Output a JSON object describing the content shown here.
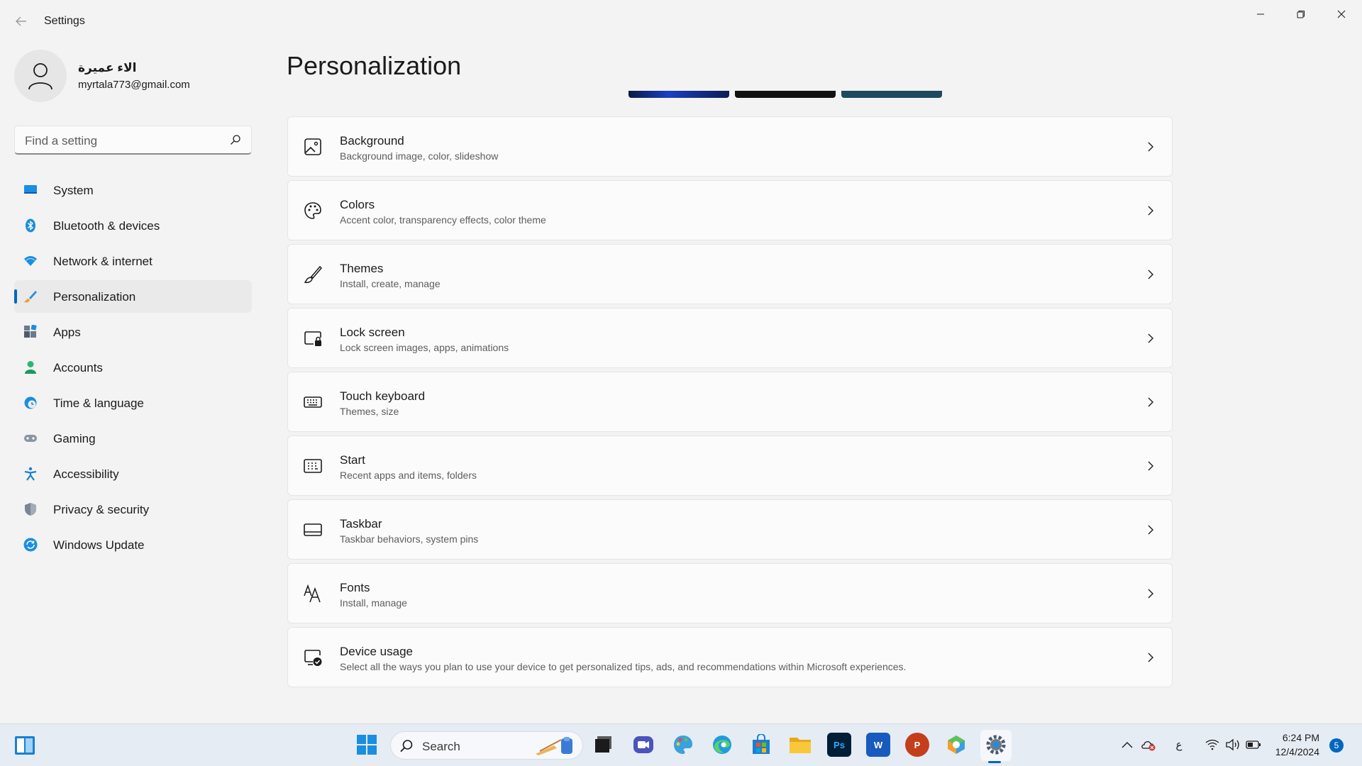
{
  "window": {
    "title": "Settings"
  },
  "profile": {
    "name": "الاء عميرة",
    "email": "myrtala773@gmail.com"
  },
  "search": {
    "placeholder": "Find a setting"
  },
  "sidebar": {
    "items": [
      {
        "label": "System",
        "icon": "system-icon",
        "active": false
      },
      {
        "label": "Bluetooth & devices",
        "icon": "bluetooth-icon",
        "active": false
      },
      {
        "label": "Network & internet",
        "icon": "wifi-icon",
        "active": false
      },
      {
        "label": "Personalization",
        "icon": "brush-icon",
        "active": true
      },
      {
        "label": "Apps",
        "icon": "apps-icon",
        "active": false
      },
      {
        "label": "Accounts",
        "icon": "accounts-icon",
        "active": false
      },
      {
        "label": "Time & language",
        "icon": "globe-clock-icon",
        "active": false
      },
      {
        "label": "Gaming",
        "icon": "gamepad-icon",
        "active": false
      },
      {
        "label": "Accessibility",
        "icon": "accessibility-icon",
        "active": false
      },
      {
        "label": "Privacy & security",
        "icon": "shield-icon",
        "active": false
      },
      {
        "label": "Windows Update",
        "icon": "update-icon",
        "active": false
      }
    ]
  },
  "main": {
    "title": "Personalization",
    "cards": [
      {
        "title": "Background",
        "subtitle": "Background image, color, slideshow",
        "icon": "image-icon"
      },
      {
        "title": "Colors",
        "subtitle": "Accent color, transparency effects, color theme",
        "icon": "palette-icon"
      },
      {
        "title": "Themes",
        "subtitle": "Install, create, manage",
        "icon": "brush-icon"
      },
      {
        "title": "Lock screen",
        "subtitle": "Lock screen images, apps, animations",
        "icon": "lock-screen-icon"
      },
      {
        "title": "Touch keyboard",
        "subtitle": "Themes, size",
        "icon": "keyboard-icon"
      },
      {
        "title": "Start",
        "subtitle": "Recent apps and items, folders",
        "icon": "start-icon"
      },
      {
        "title": "Taskbar",
        "subtitle": "Taskbar behaviors, system pins",
        "icon": "taskbar-icon"
      },
      {
        "title": "Fonts",
        "subtitle": "Install, manage",
        "icon": "fonts-icon"
      },
      {
        "title": "Device usage",
        "subtitle": "Select all the ways you plan to use your device to get personalized tips, ads, and recommendations within Microsoft experiences.",
        "icon": "device-usage-icon"
      }
    ]
  },
  "taskbar": {
    "search_placeholder": "Search",
    "apps": [
      {
        "name": "start-button-icon"
      },
      {
        "name": "task-view-icon"
      },
      {
        "name": "meet-icon"
      },
      {
        "name": "paint-icon"
      },
      {
        "name": "edge-icon"
      },
      {
        "name": "store-icon"
      },
      {
        "name": "file-explorer-icon"
      },
      {
        "name": "photoshop-icon",
        "label": "Ps"
      },
      {
        "name": "word-icon",
        "label": "W"
      },
      {
        "name": "powerpoint-icon",
        "label": "P"
      },
      {
        "name": "app-cube-icon"
      },
      {
        "name": "settings-icon"
      }
    ],
    "tray": {
      "language": "ع",
      "time": "6:24 PM",
      "date": "12/4/2024",
      "notifications": "5"
    }
  },
  "colors": {
    "accent": "#0067c0",
    "background": "#f3f3f3",
    "card": "#fbfbfb"
  }
}
